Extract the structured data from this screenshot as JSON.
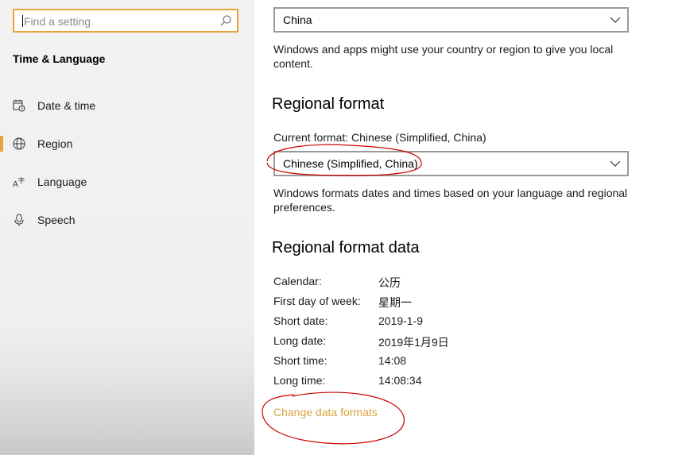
{
  "sidebar": {
    "search_placeholder": "Find a setting",
    "section_title": "Time & Language",
    "items": [
      {
        "label": "Date & time",
        "icon": "calendar-clock-icon"
      },
      {
        "label": "Region",
        "icon": "globe-icon",
        "active": true
      },
      {
        "label": "Language",
        "icon": "language-icon"
      },
      {
        "label": "Speech",
        "icon": "microphone-icon"
      }
    ]
  },
  "main": {
    "country_select_value": "China",
    "country_desc": "Windows and apps might use your country or region to give you local content.",
    "regional_format_heading": "Regional format",
    "current_format_label": "Current format: Chinese (Simplified, China)",
    "format_select_value": "Chinese (Simplified, China)",
    "format_desc": "Windows formats dates and times based on your language and regional preferences.",
    "format_data_heading": "Regional format data",
    "format_rows": [
      {
        "label": "Calendar:",
        "value": "公历"
      },
      {
        "label": "First day of week:",
        "value": "星期一"
      },
      {
        "label": "Short date:",
        "value": "2019-1-9"
      },
      {
        "label": "Long date:",
        "value": "2019年1月9日"
      },
      {
        "label": "Short time:",
        "value": "14:08"
      },
      {
        "label": "Long time:",
        "value": "14:08:34"
      }
    ],
    "change_link": "Change data formats"
  },
  "colors": {
    "accent": "#e8a33d",
    "link": "#d9a441",
    "annotation": "#cc0000"
  }
}
